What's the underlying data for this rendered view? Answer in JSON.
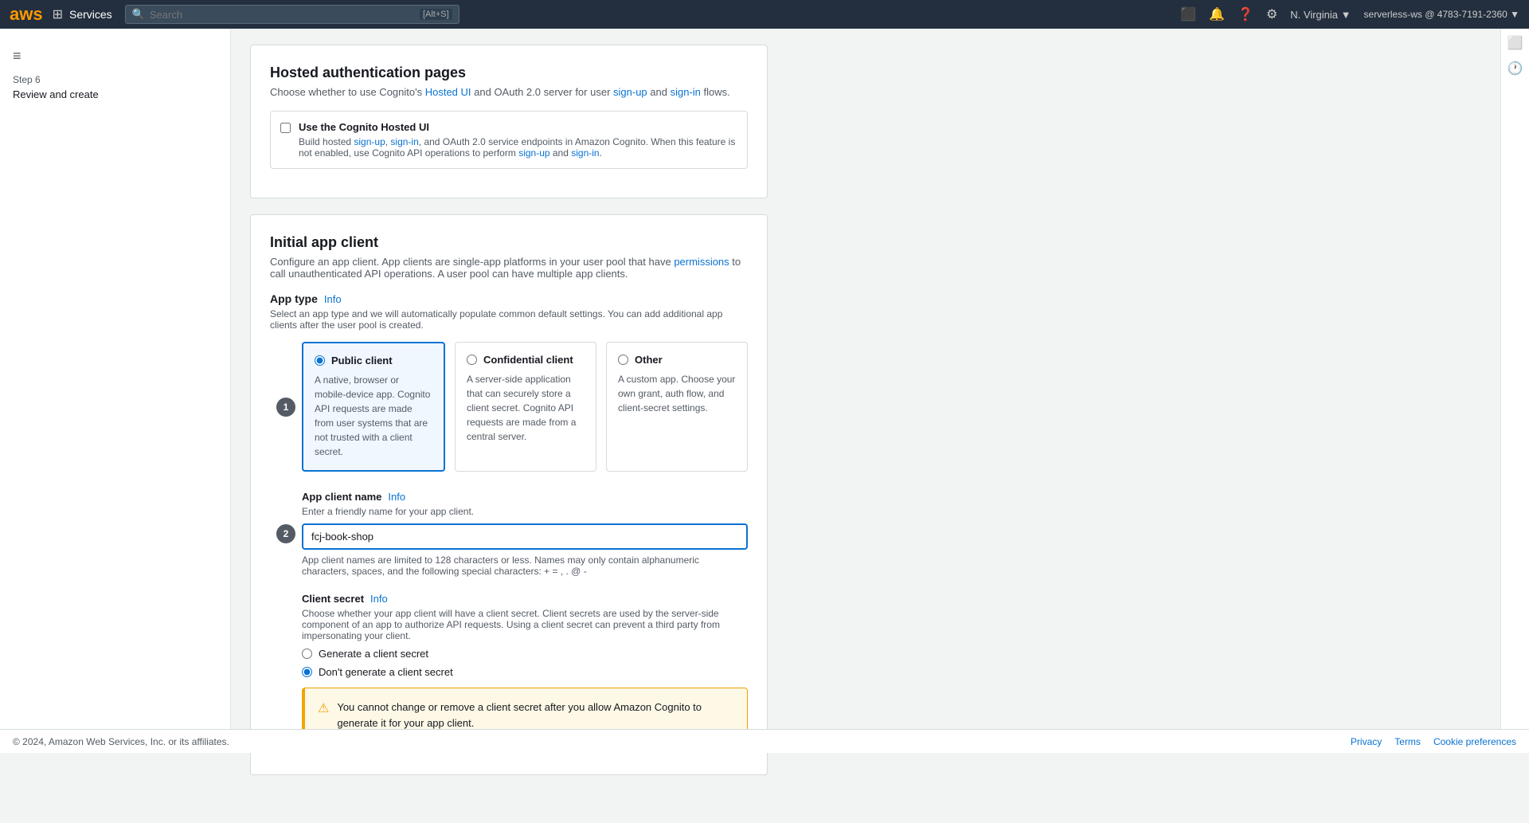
{
  "topnav": {
    "aws_logo": "aws",
    "services_label": "Services",
    "search_placeholder": "Search",
    "search_shortcut": "[Alt+S]",
    "region": "N. Virginia ▼",
    "account": "serverless-ws @ 4783-7191-2360 ▼"
  },
  "sidebar": {
    "step_number": "Step 6",
    "step_name": "Review and create"
  },
  "hosted_auth": {
    "title": "Hosted authentication pages",
    "description": "Choose whether to use Cognito's Hosted UI and OAuth 2.0 server for user sign-up and sign-in flows.",
    "checkbox_label": "Use the Cognito Hosted UI",
    "checkbox_sublabel": "Build hosted sign-up, sign-in, and OAuth 2.0 service endpoints in Amazon Cognito. When this feature is not enabled, use Cognito API operations to perform sign-up and sign-in."
  },
  "initial_app_client": {
    "title": "Initial app client",
    "description": "Configure an app client. App clients are single-app platforms in your user pool that have permissions to call unauthenticated API operations. A user pool can have multiple app clients.",
    "app_type_section": {
      "label": "App type",
      "info_link": "Info",
      "description": "Select an app type and we will automatically populate common default settings. You can add additional app clients after the user pool is created.",
      "options": [
        {
          "id": "public-client",
          "label": "Public client",
          "description": "A native, browser or mobile-device app. Cognito API requests are made from user systems that are not trusted with a client secret.",
          "selected": true
        },
        {
          "id": "confidential-client",
          "label": "Confidential client",
          "description": "A server-side application that can securely store a client secret. Cognito API requests are made from a central server.",
          "selected": false
        },
        {
          "id": "other",
          "label": "Other",
          "description": "A custom app. Choose your own grant, auth flow, and client-secret settings.",
          "selected": false
        }
      ],
      "step_badge": "1"
    },
    "app_client_name": {
      "label": "App client name",
      "info_link": "Info",
      "placeholder": "Enter a friendly name for your app client.",
      "value": "fcj-book-shop",
      "hint": "App client names are limited to 128 characters or less. Names may only contain alphanumeric characters, spaces, and the following special characters: + = , . @ -",
      "step_badge": "2"
    },
    "client_secret": {
      "label": "Client secret",
      "info_link": "Info",
      "description": "Choose whether your app client will have a client secret. Client secrets are used by the server-side component of an app to authorize API requests. Using a client secret can prevent a third party from impersonating your client.",
      "options": [
        {
          "id": "generate",
          "label": "Generate a client secret",
          "selected": false
        },
        {
          "id": "dont-generate",
          "label": "Don't generate a client secret",
          "selected": true
        }
      ],
      "warning_text": "You cannot change or remove a client secret after you allow Amazon Cognito to generate it for your app client."
    }
  },
  "footer": {
    "copyright": "© 2024, Amazon Web Services, Inc. or its affiliates.",
    "privacy": "Privacy",
    "terms": "Terms",
    "cookie_preferences": "Cookie preferences"
  }
}
